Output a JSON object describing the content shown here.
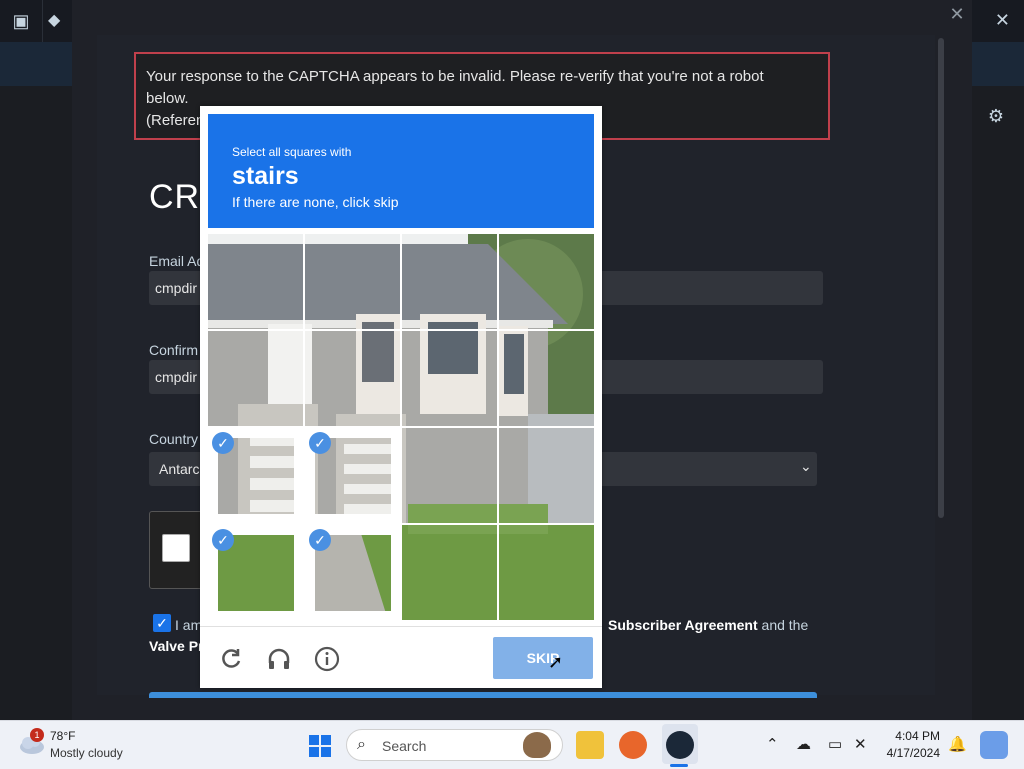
{
  "error": {
    "line1": "Your response to the CAPTCHA appears to be invalid. Please re-verify that you're not a robot",
    "line2": "below.",
    "line3": "(Referen"
  },
  "form": {
    "heading": "CRI",
    "email_label": "Email Ad",
    "email_value": "cmpdir",
    "confirm_label": "Confirm",
    "confirm_value": "cmpdir",
    "country_label": "Country",
    "country_value": "Antarc",
    "agree_prefix": "I am",
    "agree_link1": "Subscriber Agreement",
    "agree_mid": "and the",
    "agree_link2_partial": "Valve Pr"
  },
  "captcha": {
    "instruction_small": "Select all squares with",
    "target": "stairs",
    "sub": "If there are none, click skip",
    "skip_label": "SKIP",
    "reload_icon": "reload-icon",
    "audio_icon": "headphones-icon",
    "info_icon": "info-icon",
    "selected_tiles": [
      8,
      9,
      12,
      13
    ]
  },
  "taskbar": {
    "weather_temp": "78°F",
    "weather_cond": "Mostly cloudy",
    "weather_badge": "1",
    "search_placeholder": "Search",
    "time": "4:04 PM",
    "date": "4/17/2024"
  }
}
